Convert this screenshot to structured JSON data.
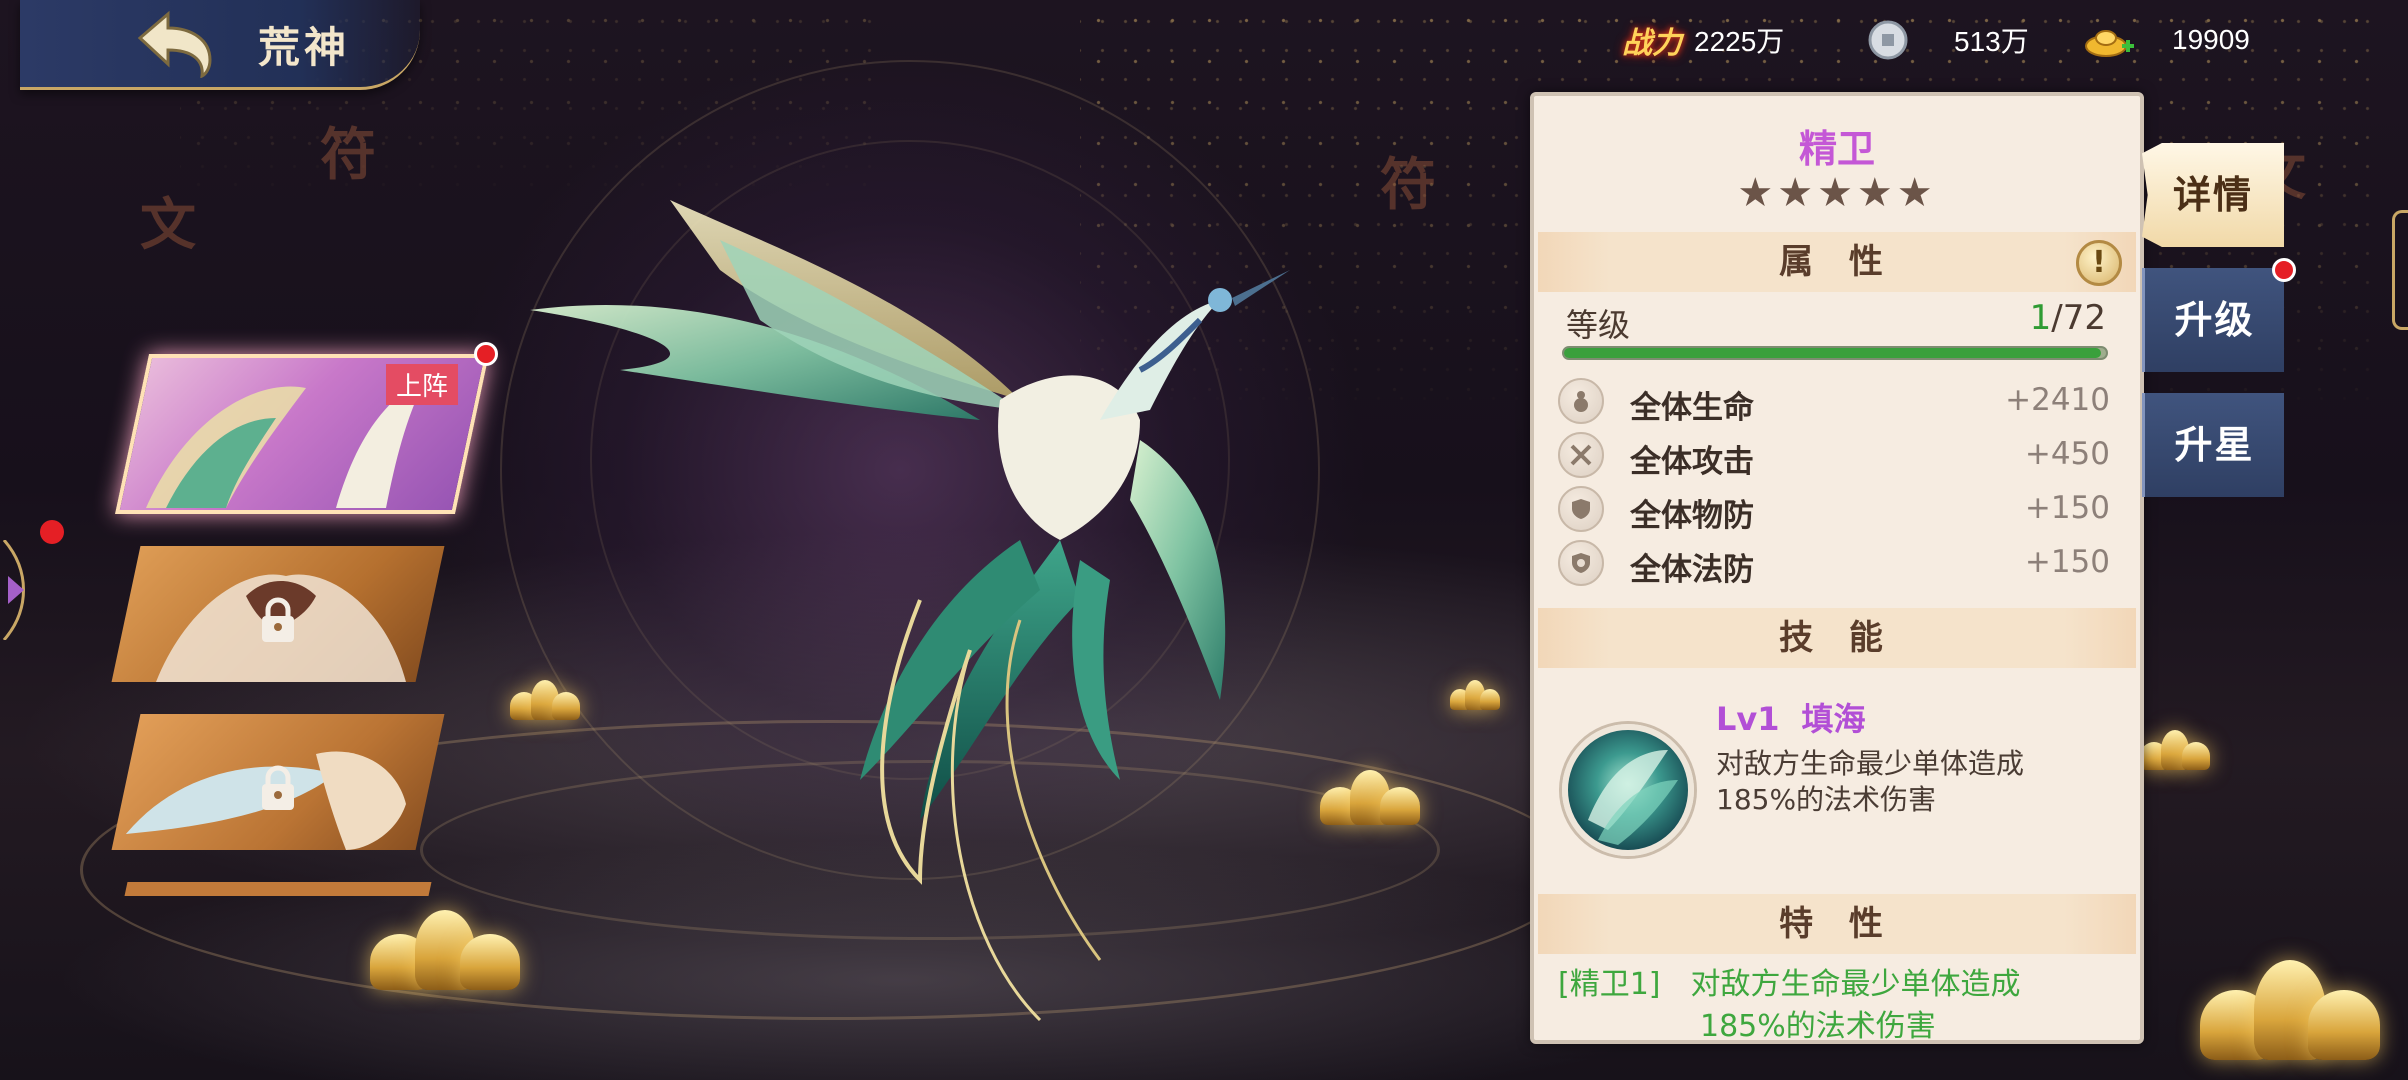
{
  "header": {
    "title": "荒神",
    "back_icon": "back-arrow-icon"
  },
  "currencies": {
    "power_label": "战力",
    "power_value": "2225万",
    "coin_icon": "silver-coin-icon",
    "coin_value": "513万",
    "ingot_icon": "gold-ingot-add-icon",
    "ingot_value": "19909"
  },
  "roster": {
    "cards": [
      {
        "state": "active",
        "tag": "上阵",
        "has_badge": true
      },
      {
        "state": "locked"
      },
      {
        "state": "locked"
      }
    ]
  },
  "panel": {
    "name": "精卫",
    "stars": "★★★★★",
    "star_count": 5,
    "attributes_header": "属 性",
    "info_button": "!",
    "level_label": "等级",
    "level_current": "1",
    "level_max": "/72",
    "level_progress": 0.99,
    "stats": [
      {
        "icon": "gourd-health-icon",
        "name": "全体生命",
        "value": "+2410"
      },
      {
        "icon": "crossed-swords-icon",
        "name": "全体攻击",
        "value": "+450"
      },
      {
        "icon": "shield-physical-icon",
        "name": "全体物防",
        "value": "+150"
      },
      {
        "icon": "shield-magic-icon",
        "name": "全体法防",
        "value": "+150"
      }
    ],
    "skill_header": "技 能",
    "skill": {
      "level": "Lv1",
      "name": "填海",
      "desc_line1": "对敌方生命最少单体造成",
      "desc_line2": "185%的法术伤害"
    },
    "trait_header": "特 性",
    "trait": {
      "tag": "[精卫1]",
      "line1": "对敌方生命最少单体造成",
      "line2": "185%的法术伤害"
    }
  },
  "tabs": {
    "details": "详情",
    "upgrade": "升级",
    "star_up": "升星"
  },
  "colors": {
    "name_purple": "#c457d6",
    "level_green": "#2f9b33",
    "trait_green": "#3ea73e",
    "panel_bg": "#f6ece1",
    "tab_blue": "#34456b",
    "badge_red": "#e51f25"
  }
}
